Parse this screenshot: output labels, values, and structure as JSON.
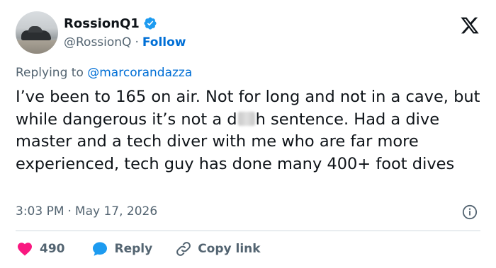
{
  "user": {
    "display_name": "RossionQ1",
    "handle": "@RossionQ",
    "follow_label": "Follow",
    "separator": "·"
  },
  "reply": {
    "prefix": "Replying to ",
    "mention": "@marcorandazza"
  },
  "tweet": {
    "text_part1": "I’ve been to 165 on air. Not for long and not in a cave, but while dangerous it’s not a d",
    "text_part2": "h sentence. Had a dive master and a tech diver with me who are far more experienced, tech guy has done many 400+ foot dives"
  },
  "meta": {
    "time": "3:03 PM",
    "separator": "·",
    "date": "May 17, 2026"
  },
  "actions": {
    "like_count": "490",
    "reply_label": "Reply",
    "copy_link_label": "Copy link"
  },
  "colors": {
    "verified": "#1d9bf0",
    "link": "#006fd6",
    "like": "#f91880",
    "reply_icon": "#1d9bf0",
    "secondary_text": "#536471"
  },
  "icons": {
    "verified": "verified-badge-icon",
    "brand": "x-logo-icon",
    "info": "info-icon",
    "like": "heart-icon",
    "reply": "speech-bubble-icon",
    "copy": "link-icon"
  }
}
